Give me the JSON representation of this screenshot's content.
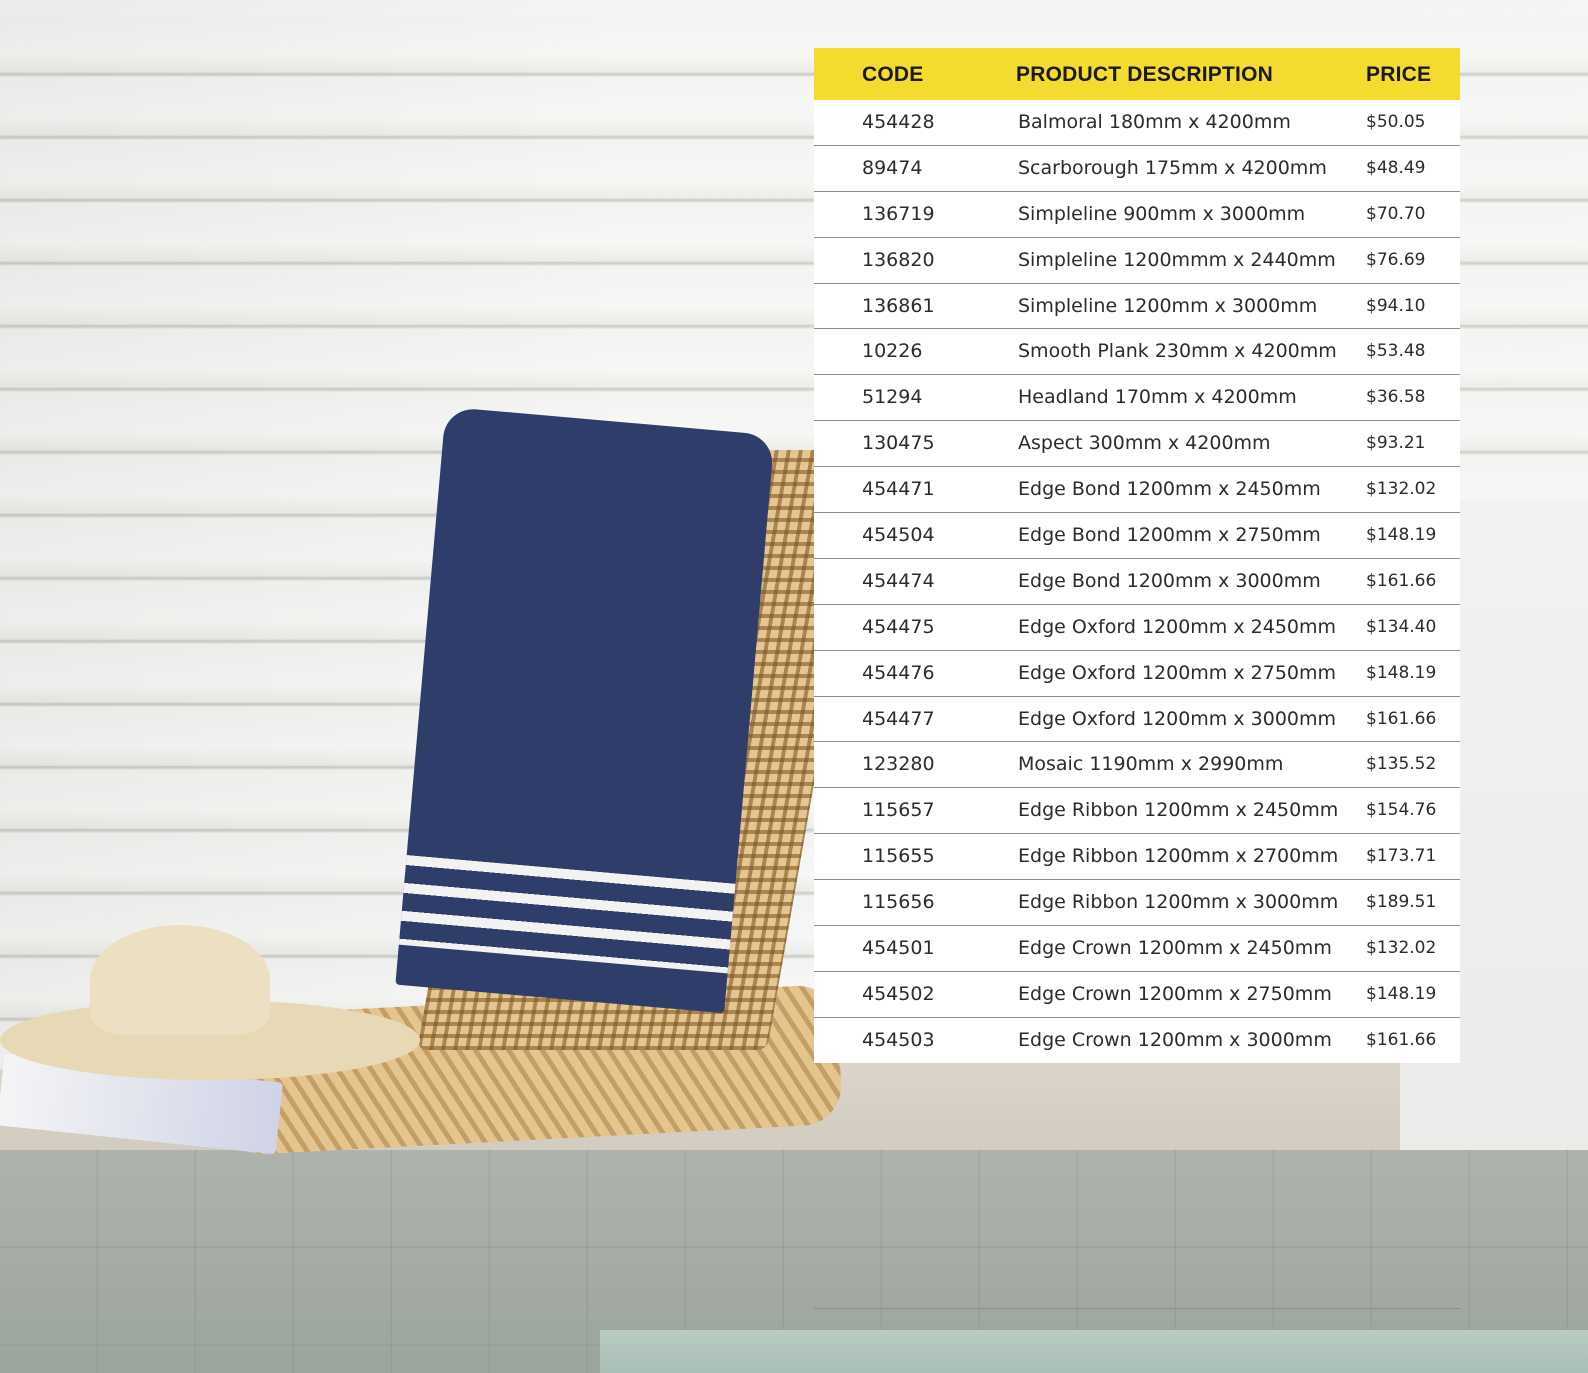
{
  "table": {
    "headers": {
      "code": "CODE",
      "description": "PRODUCT DESCRIPTION",
      "price": "PRICE"
    },
    "rows": [
      {
        "code": "454428",
        "description": "Balmoral 180mm x 4200mm",
        "price": "$50.05"
      },
      {
        "code": "89474",
        "description": "Scarborough 175mm x 4200mm",
        "price": "$48.49"
      },
      {
        "code": "136719",
        "description": "Simpleline 900mm x 3000mm",
        "price": "$70.70"
      },
      {
        "code": "136820",
        "description": "Simpleline 1200mmm x 2440mm",
        "price": "$76.69"
      },
      {
        "code": "136861",
        "description": "Simpleline 1200mm x 3000mm",
        "price": "$94.10"
      },
      {
        "code": "10226",
        "description": "Smooth Plank 230mm x 4200mm",
        "price": "$53.48"
      },
      {
        "code": "51294",
        "description": "Headland 170mm x 4200mm",
        "price": "$36.58"
      },
      {
        "code": "130475",
        "description": "Aspect 300mm x 4200mm",
        "price": "$93.21"
      },
      {
        "code": "454471",
        "description": "Edge Bond 1200mm x 2450mm",
        "price": "$132.02"
      },
      {
        "code": "454504",
        "description": "Edge Bond 1200mm x 2750mm",
        "price": "$148.19"
      },
      {
        "code": "454474",
        "description": "Edge Bond 1200mm x 3000mm",
        "price": "$161.66"
      },
      {
        "code": "454475",
        "description": "Edge Oxford 1200mm x 2450mm",
        "price": "$134.40"
      },
      {
        "code": "454476",
        "description": "Edge Oxford 1200mm x 2750mm",
        "price": "$148.19"
      },
      {
        "code": "454477",
        "description": "Edge Oxford 1200mm x 3000mm",
        "price": "$161.66"
      },
      {
        "code": "123280",
        "description": "Mosaic 1190mm x 2990mm",
        "price": "$135.52"
      },
      {
        "code": "115657",
        "description": "Edge Ribbon 1200mm x 2450mm",
        "price": "$154.76"
      },
      {
        "code": "115655",
        "description": "Edge Ribbon 1200mm x 2700mm",
        "price": "$173.71"
      },
      {
        "code": "115656",
        "description": "Edge Ribbon 1200mm x 3000mm",
        "price": "$189.51"
      },
      {
        "code": "454501",
        "description": "Edge Crown 1200mm x 2450mm",
        "price": "$132.02"
      },
      {
        "code": "454502",
        "description": "Edge Crown 1200mm x 2750mm",
        "price": "$148.19"
      },
      {
        "code": "454503",
        "description": "Edge Crown 1200mm x 3000mm",
        "price": "$161.66"
      }
    ]
  },
  "colors": {
    "header_bg": "#f3dc2e",
    "row_divider": "#8e8e8e",
    "text": "#2b2b2b"
  }
}
